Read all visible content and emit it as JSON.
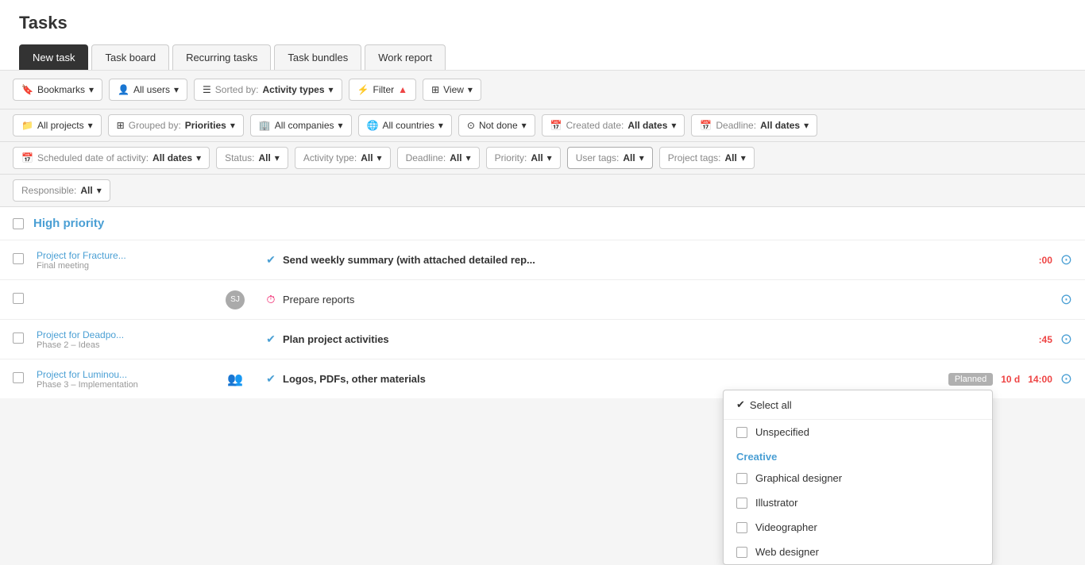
{
  "page": {
    "title": "Tasks"
  },
  "tabs": [
    {
      "id": "new-task",
      "label": "New task",
      "active": true,
      "style": "primary"
    },
    {
      "id": "task-board",
      "label": "Task board",
      "active": false
    },
    {
      "id": "recurring-tasks",
      "label": "Recurring tasks",
      "active": false
    },
    {
      "id": "task-bundles",
      "label": "Task bundles",
      "active": false
    },
    {
      "id": "work-report",
      "label": "Work report",
      "active": false
    }
  ],
  "toolbar_row1": {
    "bookmarks": "Bookmarks",
    "all_users": "All users",
    "sorted_by_label": "Sorted by:",
    "sorted_by_value": "Activity types",
    "filter": "Filter",
    "view": "View"
  },
  "toolbar_row2": {
    "all_projects": "All projects",
    "grouped_by_label": "Grouped by:",
    "grouped_by_value": "Priorities",
    "all_companies": "All companies",
    "all_countries": "All countries",
    "not_done": "Not done",
    "created_date_label": "Created date:",
    "created_date_value": "All dates",
    "deadline_label": "Deadline:",
    "deadline_value": "All dates"
  },
  "toolbar_row3": {
    "scheduled_date_label": "Scheduled date of activity:",
    "scheduled_date_value": "All dates",
    "status_label": "Status:",
    "status_value": "All",
    "activity_type_label": "Activity type:",
    "activity_type_value": "All",
    "deadline_label": "Deadline:",
    "deadline_value": "All",
    "priority_label": "Priority:",
    "priority_value": "All",
    "user_tags_label": "User tags:",
    "user_tags_value": "All",
    "project_tags_label": "Project tags:",
    "project_tags_value": "All"
  },
  "toolbar_row4": {
    "responsible_label": "Responsible:",
    "responsible_value": "All"
  },
  "dropdown": {
    "select_all": "Select all",
    "unspecified": "Unspecified",
    "category_creative": "Creative",
    "items": [
      {
        "id": "graphical-designer",
        "label": "Graphical designer"
      },
      {
        "id": "illustrator",
        "label": "Illustrator"
      },
      {
        "id": "videographer",
        "label": "Videographer"
      },
      {
        "id": "web-designer",
        "label": "Web designer"
      }
    ]
  },
  "high_priority_section": {
    "title": "High priority"
  },
  "tasks": [
    {
      "id": "task-1",
      "project": "Project for Fracture...",
      "phase": "Final meeting",
      "assignee": "",
      "status": "check",
      "name": "Send weekly summary (with attached detailed rep...",
      "name_bold": true,
      "badge": "",
      "duration": "",
      "time": ":00"
    },
    {
      "id": "task-2",
      "project": "",
      "phase": "",
      "assignee": "SJ",
      "status": "timer",
      "name": "Prepare reports",
      "name_bold": false,
      "badge": "",
      "duration": "",
      "time": ""
    },
    {
      "id": "task-3",
      "project": "Project for Deadpo...",
      "phase": "Phase 2 – Ideas",
      "assignee": "",
      "status": "check",
      "name": "Plan project activities",
      "name_bold": true,
      "badge": "",
      "duration": "",
      "time": ":45"
    },
    {
      "id": "task-4",
      "project": "Project for Luminou...",
      "phase": "Phase 3 – Implementation",
      "assignee": "people",
      "status": "check",
      "name": "Logos, PDFs, other materials",
      "name_bold": true,
      "badge": "Planned",
      "duration": "10 d",
      "time": "14:00"
    }
  ]
}
